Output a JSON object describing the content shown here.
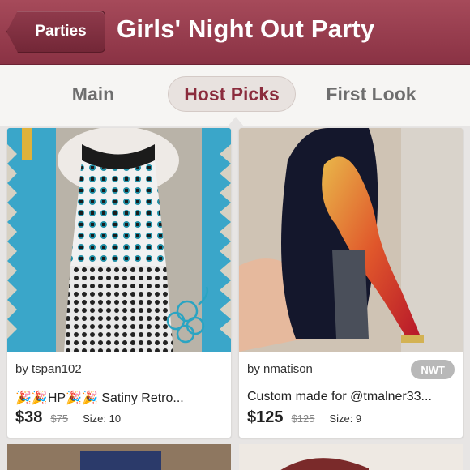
{
  "header": {
    "back_label": "Parties",
    "title": "Girls' Night Out Party"
  },
  "tabs": [
    {
      "label": "Main",
      "active": false
    },
    {
      "label": "Host Picks",
      "active": true
    },
    {
      "label": "First Look",
      "active": false
    }
  ],
  "listings": [
    {
      "seller": "by tspan102",
      "badge": "",
      "title": "🎉🎉HP🎉🎉 Satiny Retro...",
      "price": "$38",
      "original_price": "$75",
      "size": "Size: 10"
    },
    {
      "seller": "by nmatison",
      "badge": "NWT",
      "title": "Custom made for @tmalner33...",
      "price": "$125",
      "original_price": "$125",
      "size": "Size: 9"
    }
  ],
  "colors": {
    "header": "#9a3e4f",
    "active_tab_text": "#8b2c3d"
  }
}
